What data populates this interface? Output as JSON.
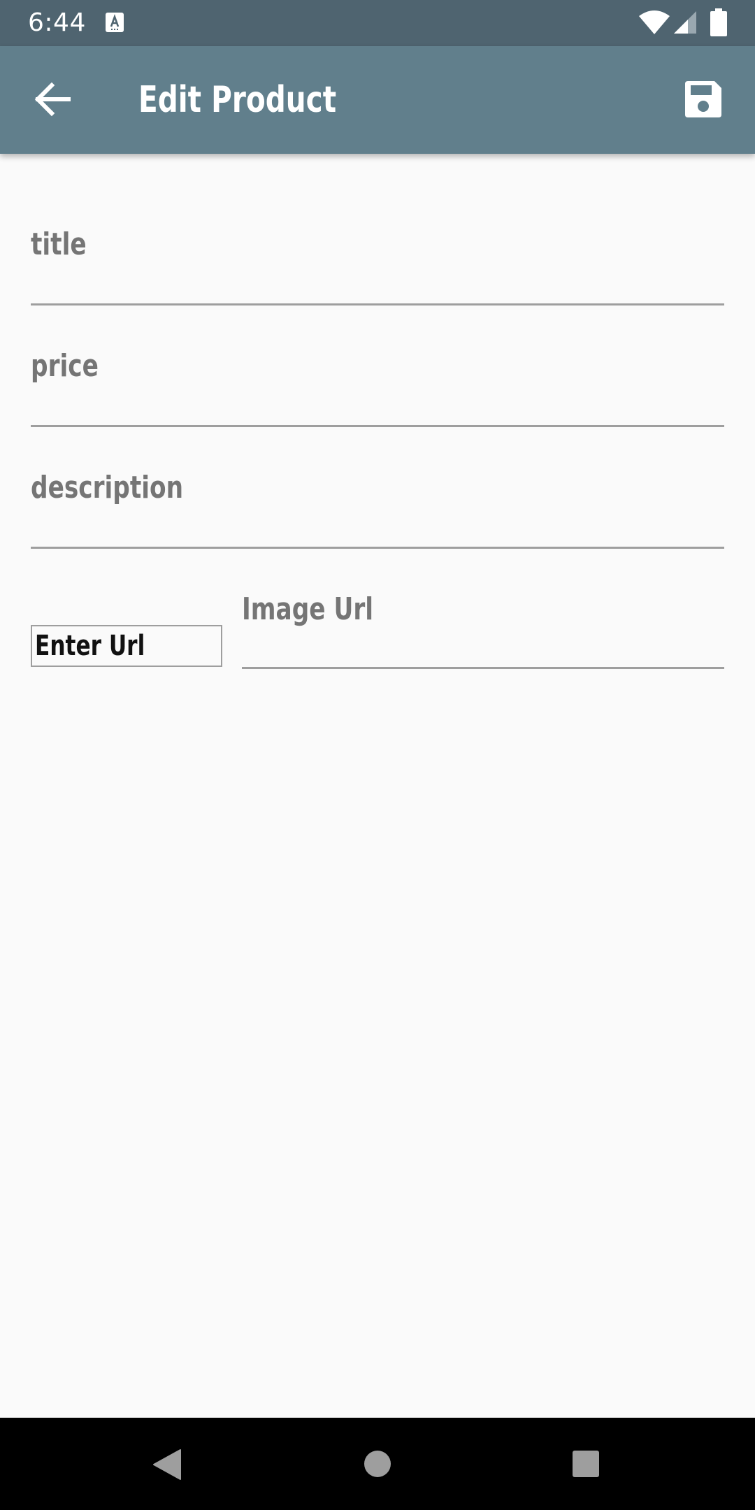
{
  "status_bar": {
    "time": "6:44",
    "icons": [
      "notification-a-icon",
      "wifi-icon",
      "cellular-signal-icon",
      "battery-icon"
    ]
  },
  "app_bar": {
    "title": "Edit Product",
    "back_icon": "arrow-back-icon",
    "save_icon": "save-floppy-icon",
    "background_color": "#617f8c"
  },
  "form": {
    "title_field": {
      "placeholder": "title",
      "value": ""
    },
    "price_field": {
      "placeholder": "price",
      "value": ""
    },
    "description_field": {
      "placeholder": "description",
      "value": ""
    },
    "image_url_field": {
      "placeholder": "Image Url",
      "value": ""
    },
    "image_preview_text": "Enter Url"
  },
  "nav_bar": {
    "icons": [
      "nav-back-icon",
      "nav-home-icon",
      "nav-recents-icon"
    ]
  }
}
